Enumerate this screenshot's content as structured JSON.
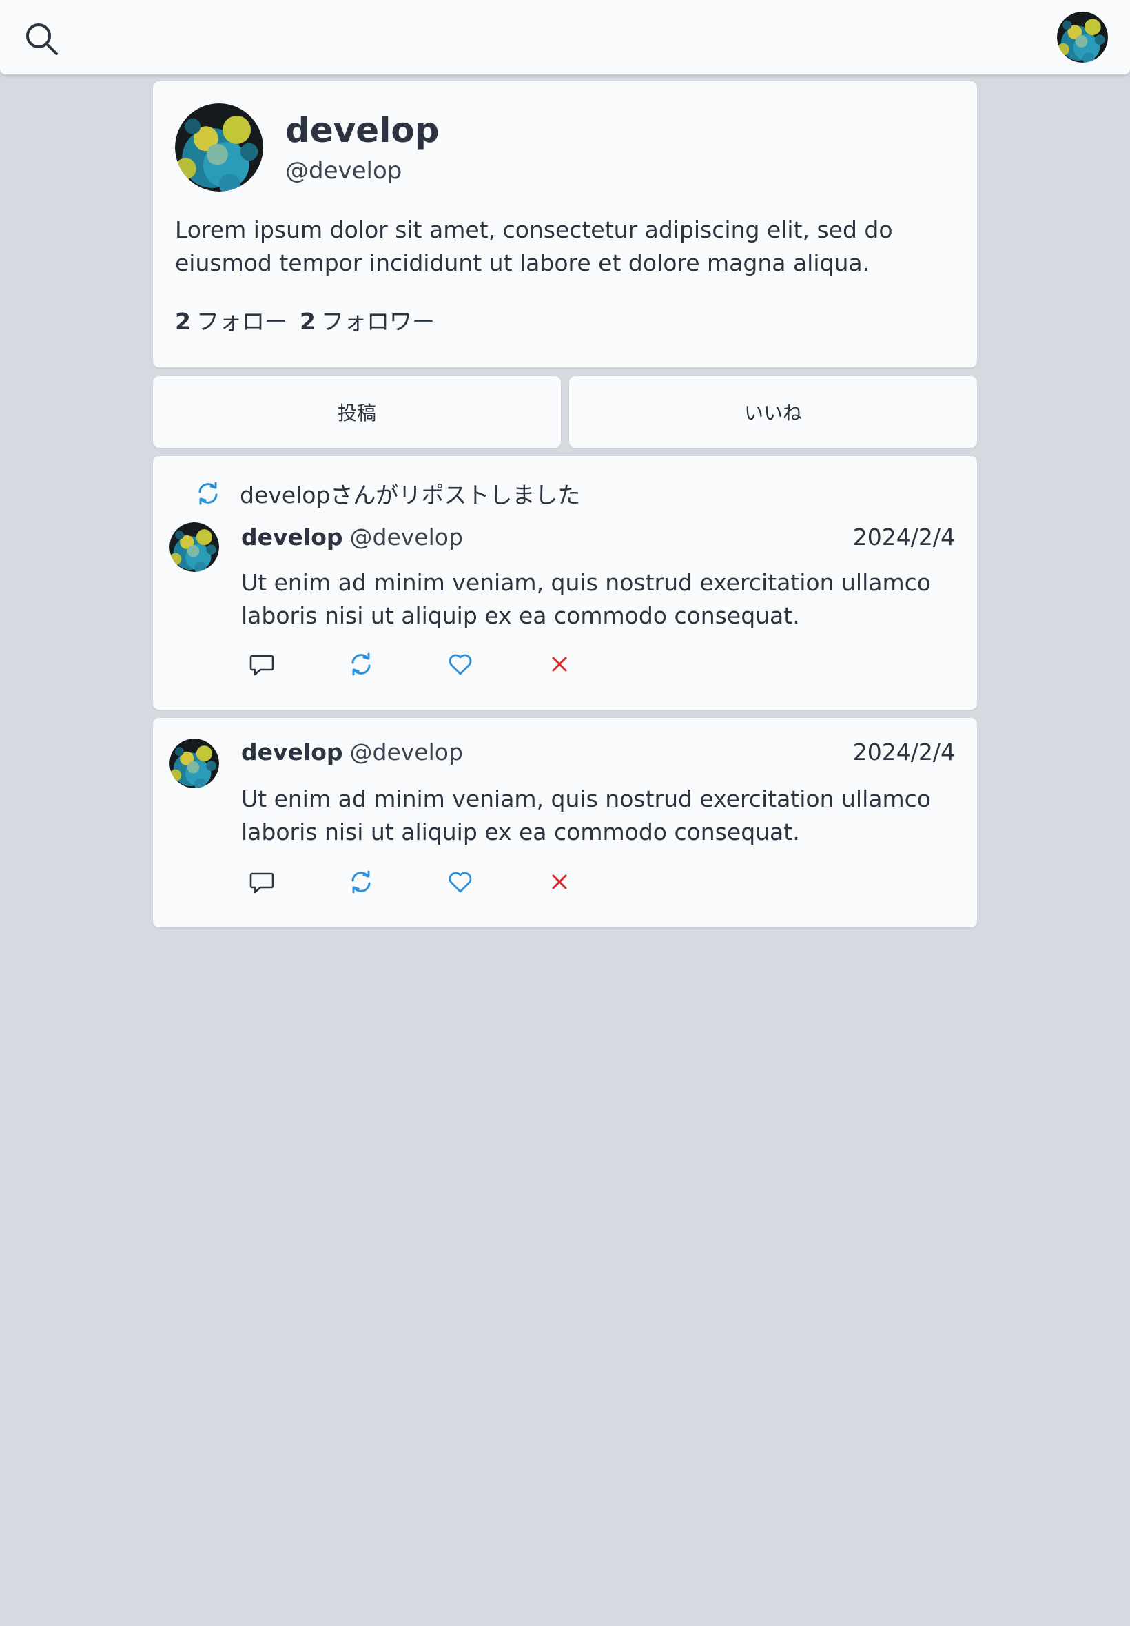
{
  "header": {
    "search_icon": "search-icon",
    "avatar_icon": "user-avatar"
  },
  "profile": {
    "name": "develop",
    "handle": "@develop",
    "bio": "Lorem ipsum dolor sit amet, consectetur adipiscing elit, sed do eiusmod tempor incididunt ut labore et dolore magna aliqua.",
    "following_count": "2",
    "following_label": "フォロー",
    "followers_count": "2",
    "followers_label": "フォロワー"
  },
  "tabs": [
    {
      "label": "投稿"
    },
    {
      "label": "いいね"
    }
  ],
  "posts": [
    {
      "repost_label": "developさんがリポストしました",
      "author": "develop",
      "handle": "@develop",
      "date": "2024/2/4",
      "body": "Ut enim ad minim veniam, quis nostrud exercitation ullamco laboris nisi ut aliquip ex ea commodo consequat."
    },
    {
      "author": "develop",
      "handle": "@develop",
      "date": "2024/2/4",
      "body": "Ut enim ad minim veniam, quis nostrud exercitation ullamco laboris nisi ut aliquip ex ea commodo consequat."
    }
  ],
  "colors": {
    "background": "#d5d9e0",
    "card": "#f9fafb",
    "text": "#2b3440",
    "accent_blue": "#2b90d9",
    "delete_red": "#d42a2a"
  }
}
